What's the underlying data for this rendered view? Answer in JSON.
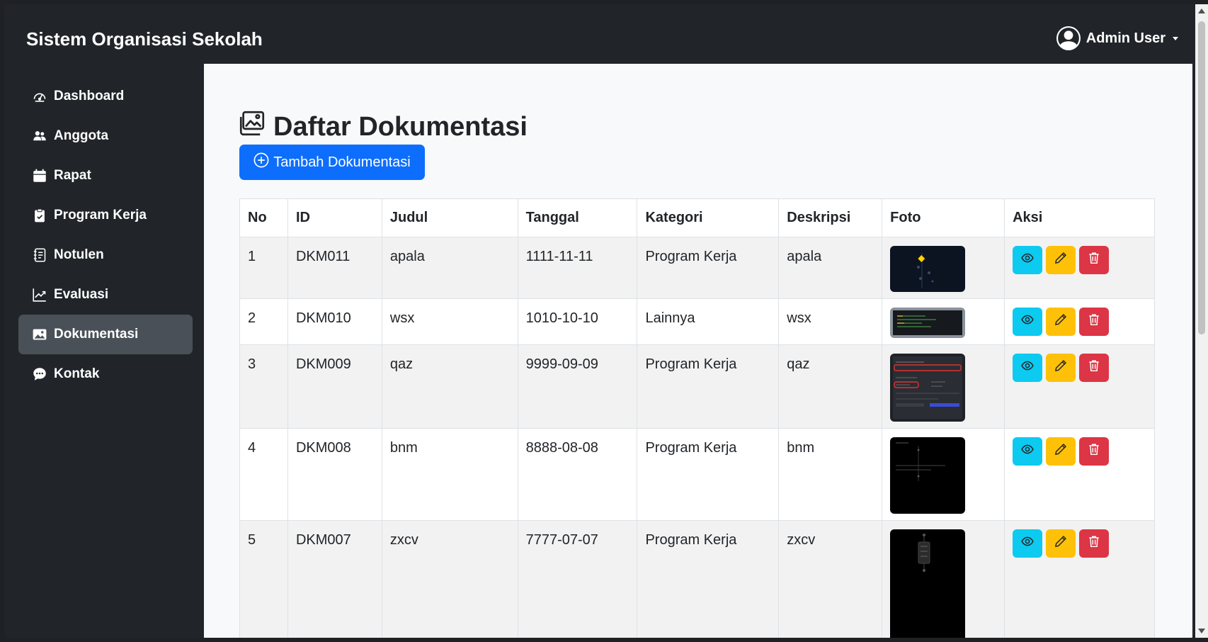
{
  "navbar": {
    "brand": "Sistem Organisasi Sekolah",
    "user_label": "Admin User",
    "user_icon": "person-circle-icon"
  },
  "sidebar": {
    "items": [
      {
        "label": "Dashboard",
        "icon": "speedometer-icon",
        "active": false
      },
      {
        "label": "Anggota",
        "icon": "people-icon",
        "active": false
      },
      {
        "label": "Rapat",
        "icon": "calendar-icon",
        "active": false
      },
      {
        "label": "Program Kerja",
        "icon": "clipboard-check-icon",
        "active": false
      },
      {
        "label": "Notulen",
        "icon": "journal-text-icon",
        "active": false
      },
      {
        "label": "Evaluasi",
        "icon": "graph-up-icon",
        "active": false
      },
      {
        "label": "Dokumentasi",
        "icon": "image-icon",
        "active": true
      },
      {
        "label": "Kontak",
        "icon": "chat-dots-icon",
        "active": false
      }
    ]
  },
  "main": {
    "title": "Daftar Dokumentasi",
    "title_icon": "images-icon",
    "add_button": "Tambah Dokumentasi",
    "add_icon": "plus-circle-icon",
    "table": {
      "headers": [
        "No",
        "ID",
        "Judul",
        "Tanggal",
        "Kategori",
        "Deskripsi",
        "Foto",
        "Aksi"
      ],
      "rows": [
        {
          "no": "1",
          "id": "DKM011",
          "judul": "apala",
          "tanggal": "1111-11-11",
          "kategori": "Program Kerja",
          "deskripsi": "apala"
        },
        {
          "no": "2",
          "id": "DKM010",
          "judul": "wsx",
          "tanggal": "1010-10-10",
          "kategori": "Lainnya",
          "deskripsi": "wsx"
        },
        {
          "no": "3",
          "id": "DKM009",
          "judul": "qaz",
          "tanggal": "9999-09-09",
          "kategori": "Program Kerja",
          "deskripsi": "qaz"
        },
        {
          "no": "4",
          "id": "DKM008",
          "judul": "bnm",
          "tanggal": "8888-08-08",
          "kategori": "Program Kerja",
          "deskripsi": "bnm"
        },
        {
          "no": "5",
          "id": "DKM007",
          "judul": "zxcv",
          "tanggal": "7777-07-07",
          "kategori": "Program Kerja",
          "deskripsi": "zxcv"
        }
      ]
    },
    "action_icons": [
      "eye-icon",
      "pencil-icon",
      "trash-icon"
    ]
  },
  "colors": {
    "navbar_bg": "#212529",
    "primary": "#0d6efd",
    "info": "#0dcaf0",
    "warning": "#ffc107",
    "danger": "#dc3545",
    "sidebar_active": "#495057"
  }
}
